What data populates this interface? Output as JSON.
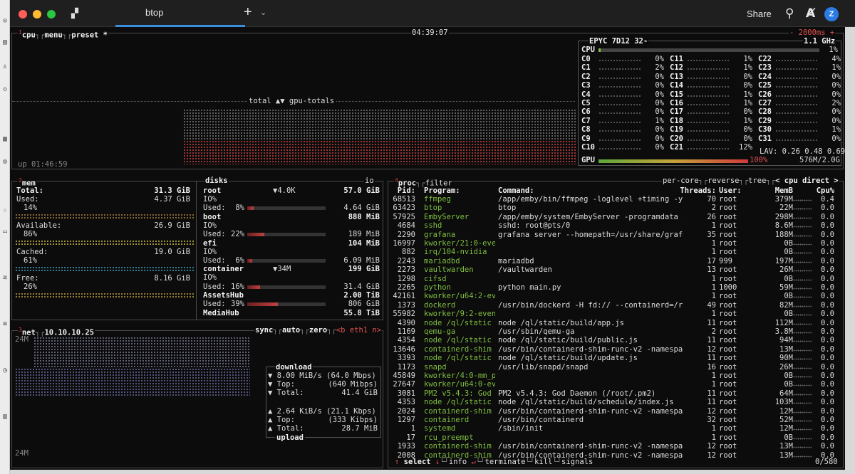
{
  "window": {
    "tab_title": "btop",
    "share": "Share",
    "avatar": "Z",
    "colors": {
      "close": "#ff5f57",
      "min": "#febc2e",
      "max": "#28c840"
    }
  },
  "cpu": {
    "tabs": [
      "cpu",
      "menu",
      "preset *"
    ],
    "clock": "04:39:07",
    "interval": "- 2000ms +",
    "model": "EPYC 7D12 32-",
    "freq": "1.1 GHz",
    "graph_label": "total ▲▼ gpu-totals",
    "uptime": "up 01:46:59",
    "cpu_total_label": "CPU",
    "cpu_total_pct": "1%",
    "cpu_total_fraction": 0.01,
    "cores": [
      {
        "n": "C0",
        "p": "0%"
      },
      {
        "n": "C1",
        "p": "2%"
      },
      {
        "n": "C2",
        "p": "0%"
      },
      {
        "n": "C3",
        "p": "0%"
      },
      {
        "n": "C4",
        "p": "0%"
      },
      {
        "n": "C5",
        "p": "0%"
      },
      {
        "n": "C6",
        "p": "0%"
      },
      {
        "n": "C7",
        "p": "1%"
      },
      {
        "n": "C8",
        "p": "0%"
      },
      {
        "n": "C9",
        "p": "0%"
      },
      {
        "n": "C10",
        "p": "0%"
      },
      {
        "n": "C11",
        "p": "1%"
      },
      {
        "n": "C12",
        "p": "1%"
      },
      {
        "n": "C13",
        "p": "0%"
      },
      {
        "n": "C14",
        "p": "0%"
      },
      {
        "n": "C15",
        "p": "1%"
      },
      {
        "n": "C16",
        "p": "1%"
      },
      {
        "n": "C17",
        "p": "0%"
      },
      {
        "n": "C18",
        "p": "1%"
      },
      {
        "n": "C19",
        "p": "0%"
      },
      {
        "n": "C20",
        "p": "0%"
      },
      {
        "n": "C21",
        "p": "12%"
      },
      {
        "n": "C22",
        "p": "4%"
      },
      {
        "n": "C23",
        "p": "1%"
      },
      {
        "n": "C24",
        "p": "0%"
      },
      {
        "n": "C25",
        "p": "0%"
      },
      {
        "n": "C26",
        "p": "0%"
      },
      {
        "n": "C27",
        "p": "2%"
      },
      {
        "n": "C28",
        "p": "0%"
      },
      {
        "n": "C29",
        "p": "0%"
      },
      {
        "n": "C30",
        "p": "1%"
      },
      {
        "n": "C31",
        "p": "0%"
      }
    ],
    "lav": "LAV: 0.26 0.48 0.69",
    "gpu_label": "GPU",
    "gpu_pct": "100%",
    "gpu_fraction": 1.0,
    "gpu_mem": "576M/2.0G"
  },
  "mem": {
    "title": "mem",
    "disks_title": "disks",
    "io": "io",
    "total_label": "Total:",
    "total": "31.3 GiB",
    "rows": [
      {
        "label": "Used:",
        "value": "4.37 GiB",
        "pct": "14%"
      },
      {
        "label": "Available:",
        "value": "26.9 GiB",
        "pct": "86%"
      },
      {
        "label": "Cached:",
        "value": "19.0 GiB",
        "pct": "61%"
      },
      {
        "label": "Free:",
        "value": "8.16 GiB",
        "pct": "26%"
      }
    ]
  },
  "disks": [
    {
      "name": "root",
      "io": "▼4.0K",
      "size": "57.0 GiB",
      "io_label": "IO%",
      "used_pct": "8%",
      "used_frac": 0.08,
      "used": "4.64 GiB"
    },
    {
      "name": "boot",
      "io": "",
      "size": "880 MiB",
      "io_label": "IO%",
      "used_pct": "22%",
      "used_frac": 0.22,
      "used": "189 MiB"
    },
    {
      "name": "efi",
      "io": "",
      "size": "104 MiB",
      "io_label": "IO%",
      "used_pct": "6%",
      "used_frac": 0.06,
      "used": "6.09 MiB"
    },
    {
      "name": "container",
      "io": "▼34M",
      "size": "199 GiB",
      "io_label": "IO%",
      "used_pct": "16%",
      "used_frac": 0.16,
      "used": "31.4 GiB"
    },
    {
      "name": "AssetsHub",
      "io": "",
      "size": "2.00 TiB",
      "io_label": "",
      "used_pct": "39%",
      "used_frac": 0.39,
      "used": "806 GiB"
    },
    {
      "name": "MediaHub",
      "io": "",
      "size": "55.8 TiB",
      "io_label": "",
      "used_pct": "",
      "used_frac": 0,
      "used": ""
    }
  ],
  "net": {
    "title": "net",
    "ip": "10.10.10.25",
    "tabs": [
      "sync",
      "auto",
      "zero",
      "<b eth1 n>"
    ],
    "scale_top": "24M",
    "scale_bottom": "24M",
    "download_label": "download",
    "down_rate": "▼ 8.00 MiB/s (64.0 Mbps)",
    "down_top_label": "▼ Top:",
    "down_top": "(640 Mibps)",
    "down_total_label": "▼ Total:",
    "down_total": "41.4 GiB",
    "up_rate": "▲ 2.64 KiB/s (21.1 Kbps)",
    "up_top_label": "▲ Top:",
    "up_top": "(333 Kibps)",
    "up_total_label": "▲ Total:",
    "up_total": "28.7 MiB",
    "upload_label": "upload"
  },
  "proc": {
    "title": "proc",
    "filter": "filter",
    "opts": [
      "per-core",
      "reverse",
      "tree",
      "< cpu direct >"
    ],
    "headers": {
      "pid": "Pid:",
      "prog": "Program:",
      "cmd": "Command:",
      "thr": "Threads:",
      "user": "User:",
      "mem": "MemB",
      "cpu": "Cpu%"
    },
    "rows": [
      [
        "68513",
        "ffmpeg",
        "/app/emby/bin/ffmpeg -loglevel +timing -y",
        "70",
        "root",
        "379M",
        "0.4"
      ],
      [
        "63423",
        "btop",
        "btop",
        "2",
        "root",
        "22M",
        "0.0"
      ],
      [
        "57925",
        "EmbyServer",
        "/app/emby/system/EmbyServer -programdata /",
        "26",
        "root",
        "298M",
        "0.0"
      ],
      [
        "4684",
        "sshd",
        "sshd: root@pts/0",
        "1",
        "root",
        "8.6M",
        "0.0"
      ],
      [
        "2290",
        "grafana",
        "grafana server --homepath=/usr/share/grafa",
        "35",
        "root",
        "188M",
        "0.0"
      ],
      [
        "16997",
        "kworker/21:0-eve",
        "",
        "1",
        "root",
        "0B",
        "0.0"
      ],
      [
        "882",
        "irq/104-nvidia",
        "",
        "1",
        "root",
        "0B",
        "0.0"
      ],
      [
        "2243",
        "mariadbd",
        "mariadbd",
        "17",
        "999",
        "197M",
        "0.0"
      ],
      [
        "2273",
        "vaultwarden",
        "/vaultwarden",
        "13",
        "root",
        "26M",
        "0.0"
      ],
      [
        "1298",
        "cifsd",
        "",
        "1",
        "root",
        "0B",
        "0.0"
      ],
      [
        "2265",
        "python",
        "python main.py",
        "1",
        "1000",
        "59M",
        "0.0"
      ],
      [
        "42161",
        "kworker/u64:2-ev",
        "",
        "1",
        "root",
        "0B",
        "0.0"
      ],
      [
        "1373",
        "dockerd",
        "/usr/bin/dockerd -H fd:// --containerd=/ru",
        "49",
        "root",
        "82M",
        "0.0"
      ],
      [
        "55982",
        "kworker/9:2-even",
        "",
        "1",
        "root",
        "0B",
        "0.0"
      ],
      [
        "4390",
        "node /ql/static",
        "node /ql/static/build/app.js",
        "11",
        "root",
        "112M",
        "0.0"
      ],
      [
        "1169",
        "qemu-ga",
        "/usr/sbin/qemu-ga",
        "2",
        "root",
        "3.8M",
        "0.0"
      ],
      [
        "4354",
        "node /ql/static",
        "node /ql/static/build/public.js",
        "11",
        "root",
        "94M",
        "0.0"
      ],
      [
        "13646",
        "containerd-shim",
        "/usr/bin/containerd-shim-runc-v2 -namespac",
        "12",
        "root",
        "13M",
        "0.0"
      ],
      [
        "3393",
        "node /ql/static",
        "node /ql/static/build/update.js",
        "11",
        "root",
        "90M",
        "0.0"
      ],
      [
        "1173",
        "snapd",
        "/usr/lib/snapd/snapd",
        "16",
        "root",
        "26M",
        "0.0"
      ],
      [
        "45849",
        "kworker/4:0-mm_p",
        "",
        "1",
        "root",
        "0B",
        "0.0"
      ],
      [
        "27647",
        "kworker/u64:0-ev",
        "",
        "1",
        "root",
        "0B",
        "0.0"
      ],
      [
        "3081",
        "PM2 v5.4.3: God",
        "PM2 v5.4.3: God Daemon (/root/.pm2)",
        "11",
        "root",
        "64M",
        "0.0"
      ],
      [
        "4353",
        "node /ql/static",
        "node /ql/static/build/schedule/index.js",
        "11",
        "root",
        "103M",
        "0.0"
      ],
      [
        "2024",
        "containerd-shim",
        "/usr/bin/containerd-shim-runc-v2 -namespac",
        "12",
        "root",
        "12M",
        "0.0"
      ],
      [
        "1297",
        "containerd",
        "/usr/bin/containerd",
        "32",
        "root",
        "52M",
        "0.0"
      ],
      [
        "1",
        "systemd",
        "/sbin/init",
        "1",
        "root",
        "12M",
        "0.0"
      ],
      [
        "17",
        "rcu_preempt",
        "",
        "1",
        "root",
        "0B",
        "0.0"
      ],
      [
        "1933",
        "containerd-shim",
        "/usr/bin/containerd-shim-runc-v2 -namespac",
        "12",
        "root",
        "13M",
        "0.0"
      ],
      [
        "2008",
        "containerd-shim",
        "/usr/bin/containerd-shim-runc-v2 -namespac",
        "12",
        "root",
        "13M",
        "0.0"
      ]
    ],
    "footer": [
      "select",
      "info",
      "terminate",
      "kill",
      "signals"
    ],
    "count": "0/580"
  }
}
